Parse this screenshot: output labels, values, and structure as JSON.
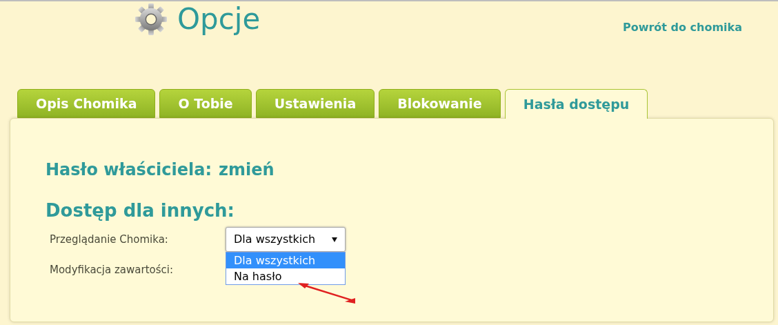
{
  "header": {
    "title": "Opcje",
    "back_link": "Powrót do chomika"
  },
  "tabs": [
    {
      "label": "Opis Chomika",
      "selected": false
    },
    {
      "label": "O Tobie",
      "selected": false
    },
    {
      "label": "Ustawienia",
      "selected": false
    },
    {
      "label": "Blokowanie",
      "selected": false
    },
    {
      "label": "Hasła dostępu",
      "selected": true
    }
  ],
  "owner_password": {
    "label": "Hasło właściciela:",
    "link": "zmień"
  },
  "access": {
    "heading": "Dostęp dla innych:",
    "rows": [
      {
        "label": "Przeglądanie Chomika:",
        "value": "Dla wszystkich",
        "expanded": true,
        "options": [
          {
            "label": "Dla wszystkich",
            "selected": true
          },
          {
            "label": "Na hasło",
            "selected": false
          }
        ]
      },
      {
        "label": "Modyfikacja zawartości:"
      }
    ]
  }
}
